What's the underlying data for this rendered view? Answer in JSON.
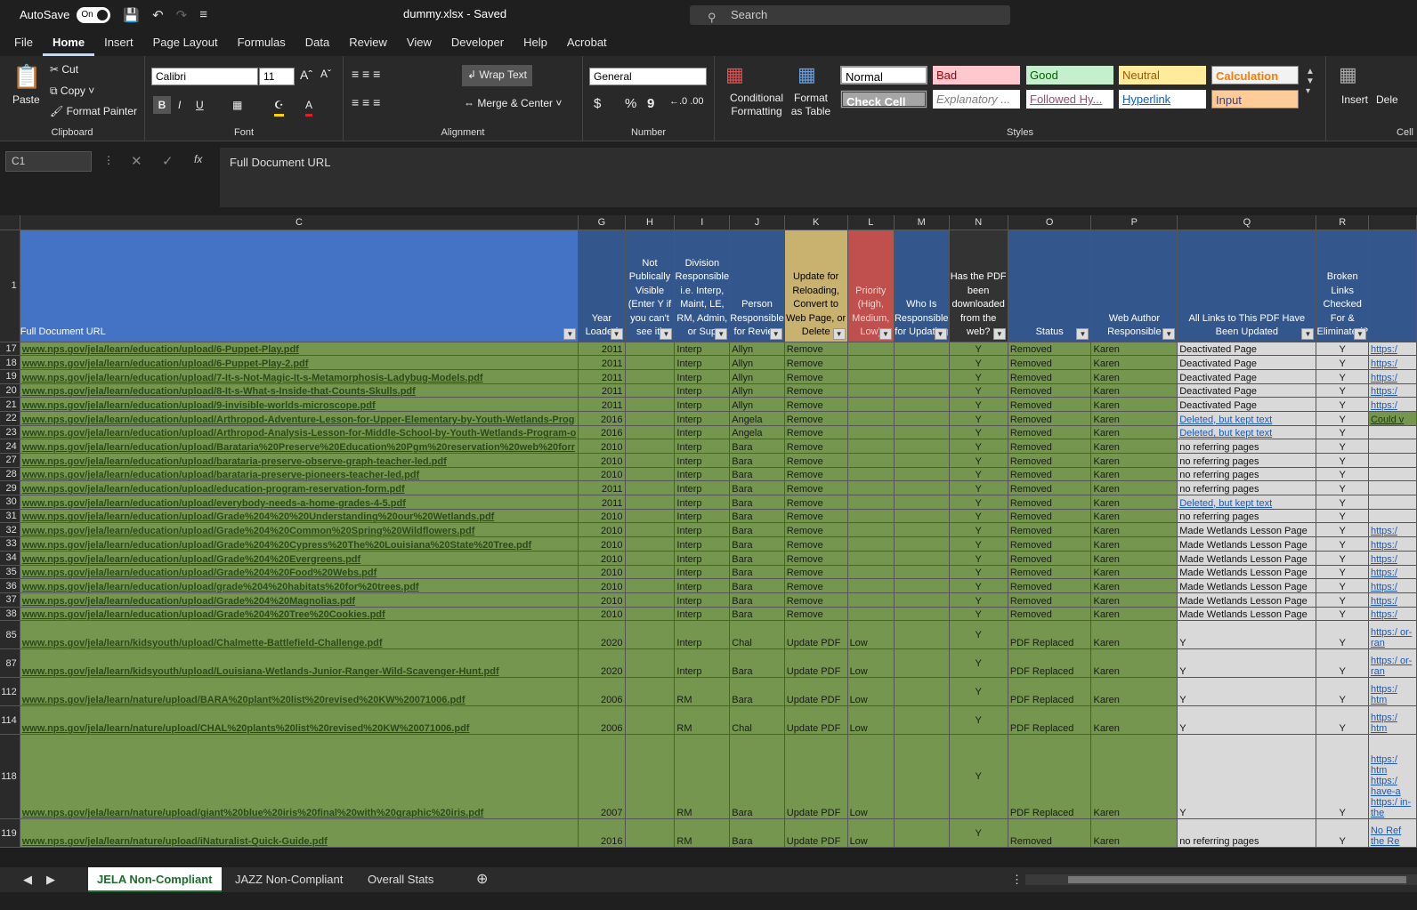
{
  "titlebar": {
    "autosave_label": "AutoSave",
    "autosave_state": "On",
    "doc_title": "dummy.xlsx - Saved",
    "search_placeholder": "Search"
  },
  "menu": [
    "File",
    "Home",
    "Insert",
    "Page Layout",
    "Formulas",
    "Data",
    "Review",
    "View",
    "Developer",
    "Help",
    "Acrobat"
  ],
  "ribbon": {
    "clipboard": {
      "paste": "Paste",
      "cut": "Cut",
      "copy": "Copy",
      "format_painter": "Format Painter",
      "label": "Clipboard"
    },
    "font": {
      "name": "Calibri",
      "size": "11",
      "label": "Font",
      "bold": "B",
      "italic": "I",
      "underline": "U"
    },
    "alignment": {
      "wrap": "Wrap Text",
      "merge": "Merge & Center",
      "label": "Alignment"
    },
    "number": {
      "format": "General",
      "label": "Number",
      "dollar": "$",
      "percent": "%",
      "comma": "9"
    },
    "styles": {
      "conditional": "Conditional Formatting",
      "format_table": "Format as Table",
      "label": "Styles",
      "cells": [
        "Normal",
        "Bad",
        "Good",
        "Neutral",
        "Calculation",
        "Check Cell",
        "Explanatory ...",
        "Followed Hy...",
        "Hyperlink",
        "Input"
      ]
    },
    "cells": {
      "insert": "Insert",
      "delete": "Dele",
      "label": "Cell"
    }
  },
  "formula_bar": {
    "name_box": "C1",
    "content": "Full Document URL",
    "fx": "fx"
  },
  "columns": [
    "C",
    "G",
    "H",
    "I",
    "J",
    "K",
    "L",
    "M",
    "N",
    "O",
    "P",
    "Q",
    "R"
  ],
  "headers": {
    "C": "Full Document URL",
    "G": "Year Loaded",
    "H": "Not Publically Visible (Enter Y if you can't see it)",
    "I": "Division Responsible i.e. Interp, Maint, LE, RM, Admin, or Sup",
    "J": "Person Responsible for Review",
    "K": "Update for Reloading, Convert to Web Page, or Delete",
    "L": "Priority (High, Medium, Low)",
    "M": "Who Is Responsible for Updating",
    "N": "Has the PDF been downloaded from the web?",
    "O": "Status",
    "P": "Web Author Responsible",
    "Q": "All Links to This PDF Have Been Updated",
    "R": "Broken Links Checked For & Eliminated?"
  },
  "rows": [
    {
      "n": "17",
      "url": "www.nps.gov/jela/learn/education/upload/6-Puppet-Play.pdf",
      "g": "2011",
      "i": "Interp",
      "j": "Allyn",
      "k": "Remove",
      "l": "",
      "n2": "Y",
      "o": "Removed",
      "p": "Karen",
      "q": "Deactivated Page",
      "r": "Y",
      "s": "https:/"
    },
    {
      "n": "18",
      "url": "www.nps.gov/jela/learn/education/upload/6-Puppet-Play-2.pdf",
      "g": "2011",
      "i": "Interp",
      "j": "Allyn",
      "k": "Remove",
      "l": "",
      "n2": "Y",
      "o": "Removed",
      "p": "Karen",
      "q": "Deactivated Page",
      "r": "Y",
      "s": "https:/"
    },
    {
      "n": "19",
      "url": "www.nps.gov/jela/learn/education/upload/7-It-s-Not-Magic-It-s-Metamorphosis-Ladybug-Models.pdf",
      "g": "2011",
      "i": "Interp",
      "j": "Allyn",
      "k": "Remove",
      "l": "",
      "n2": "Y",
      "o": "Removed",
      "p": "Karen",
      "q": "Deactivated Page",
      "r": "Y",
      "s": "https:/"
    },
    {
      "n": "20",
      "url": "www.nps.gov/jela/learn/education/upload/8-It-s-What-s-Inside-that-Counts-Skulls.pdf",
      "g": "2011",
      "i": "Interp",
      "j": "Allyn",
      "k": "Remove",
      "l": "",
      "n2": "Y",
      "o": "Removed",
      "p": "Karen",
      "q": "Deactivated Page",
      "r": "Y",
      "s": "https:/"
    },
    {
      "n": "21",
      "url": "www.nps.gov/jela/learn/education/upload/9-invisible-worlds-microscope.pdf",
      "g": "2011",
      "i": "Interp",
      "j": "Allyn",
      "k": "Remove",
      "l": "",
      "n2": "Y",
      "o": "Removed",
      "p": "Karen",
      "q": "Deactivated Page",
      "r": "Y",
      "s": "https:/"
    },
    {
      "n": "22",
      "url": "www.nps.gov/jela/learn/education/upload/Arthropod-Adventure-Lesson-for-Upper-Elementary-by-Youth-Wetlands-Prog",
      "g": "2016",
      "i": "Interp",
      "j": "Angela",
      "k": "Remove",
      "l": "",
      "n2": "Y",
      "o": "Removed",
      "p": "Karen",
      "q": "Deleted, but kept text",
      "qlink": true,
      "r": "Y",
      "s": "Could v"
    },
    {
      "n": "23",
      "url": "www.nps.gov/jela/learn/education/upload/Arthropod-Analysis-Lesson-for-Middle-School-by-Youth-Wetlands-Program-o",
      "g": "2016",
      "i": "Interp",
      "j": "Angela",
      "k": "Remove",
      "l": "",
      "n2": "Y",
      "o": "Removed",
      "p": "Karen",
      "q": "Deleted, but kept text",
      "qlink": true,
      "r": "Y",
      "s": ""
    },
    {
      "n": "24",
      "url": "www.nps.gov/jela/learn/education/upload/Barataria%20Preserve%20Education%20Pgm%20reservation%20web%20forr",
      "g": "2010",
      "i": "Interp",
      "j": "Bara",
      "k": "Remove",
      "l": "",
      "n2": "Y",
      "o": "Removed",
      "p": "Karen",
      "q": "no referring pages",
      "r": "Y",
      "s": ""
    },
    {
      "n": "27",
      "url": "www.nps.gov/jela/learn/education/upload/barataria-preserve-observe-graph-teacher-led.pdf",
      "g": "2010",
      "i": "Interp",
      "j": "Bara",
      "k": "Remove",
      "l": "",
      "n2": "Y",
      "o": "Removed",
      "p": "Karen",
      "q": "no referring pages",
      "r": "Y",
      "s": ""
    },
    {
      "n": "28",
      "url": "www.nps.gov/jela/learn/education/upload/barataria-preserve-pioneers-teacher-led.pdf",
      "g": "2010",
      "i": "Interp",
      "j": "Bara",
      "k": "Remove",
      "l": "",
      "n2": "Y",
      "o": "Removed",
      "p": "Karen",
      "q": "no referring pages",
      "r": "Y",
      "s": ""
    },
    {
      "n": "29",
      "url": "www.nps.gov/jela/learn/education/upload/education-program-reservation-form.pdf",
      "g": "2011",
      "i": "Interp",
      "j": "Bara",
      "k": "Remove",
      "l": "",
      "n2": "Y",
      "o": "Removed",
      "p": "Karen",
      "q": "no referring pages",
      "r": "Y",
      "s": ""
    },
    {
      "n": "30",
      "url": "www.nps.gov/jela/learn/education/upload/everybody-needs-a-home-grades-4-5.pdf",
      "g": "2011",
      "i": "Interp",
      "j": "Bara",
      "k": "Remove",
      "l": "",
      "n2": "Y",
      "o": "Removed",
      "p": "Karen",
      "q": "Deleted, but kept text",
      "qlink": true,
      "r": "Y",
      "s": ""
    },
    {
      "n": "31",
      "url": "www.nps.gov/jela/learn/education/upload/Grade%204%20%20Understanding%20our%20Wetlands.pdf",
      "g": "2010",
      "i": "Interp",
      "j": "Bara",
      "k": "Remove",
      "l": "",
      "n2": "Y",
      "o": "Removed",
      "p": "Karen",
      "q": "no referring pages",
      "r": "Y",
      "s": ""
    },
    {
      "n": "32",
      "url": "www.nps.gov/jela/learn/education/upload/Grade%204%20Common%20Spring%20Wildflowers.pdf",
      "g": "2010",
      "i": "Interp",
      "j": "Bara",
      "k": "Remove",
      "l": "",
      "n2": "Y",
      "o": "Removed",
      "p": "Karen",
      "q": "Made Wetlands Lesson Page",
      "r": "Y",
      "s": "https:/"
    },
    {
      "n": "33",
      "url": "www.nps.gov/jela/learn/education/upload/Grade%204%20Cypress%20The%20Louisiana%20State%20Tree.pdf",
      "g": "2010",
      "i": "Interp",
      "j": "Bara",
      "k": "Remove",
      "l": "",
      "n2": "Y",
      "o": "Removed",
      "p": "Karen",
      "q": "Made Wetlands Lesson Page",
      "r": "Y",
      "s": "https:/"
    },
    {
      "n": "34",
      "url": "www.nps.gov/jela/learn/education/upload/Grade%204%20Evergreens.pdf",
      "g": "2010",
      "i": "Interp",
      "j": "Bara",
      "k": "Remove",
      "l": "",
      "n2": "Y",
      "o": "Removed",
      "p": "Karen",
      "q": "Made Wetlands Lesson Page",
      "r": "Y",
      "s": "https:/"
    },
    {
      "n": "35",
      "url": "www.nps.gov/jela/learn/education/upload/Grade%204%20Food%20Webs.pdf",
      "g": "2010",
      "i": "Interp",
      "j": "Bara",
      "k": "Remove",
      "l": "",
      "n2": "Y",
      "o": "Removed",
      "p": "Karen",
      "q": "Made Wetlands Lesson Page",
      "r": "Y",
      "s": "https:/"
    },
    {
      "n": "36",
      "url": "www.nps.gov/jela/learn/education/upload/grade%204%20habitats%20for%20trees.pdf",
      "g": "2010",
      "i": "Interp",
      "j": "Bara",
      "k": "Remove",
      "l": "",
      "n2": "Y",
      "o": "Removed",
      "p": "Karen",
      "q": "Made Wetlands Lesson Page",
      "r": "Y",
      "s": "https:/"
    },
    {
      "n": "37",
      "url": "www.nps.gov/jela/learn/education/upload/Grade%204%20Magnolias.pdf",
      "g": "2010",
      "i": "Interp",
      "j": "Bara",
      "k": "Remove",
      "l": "",
      "n2": "Y",
      "o": "Removed",
      "p": "Karen",
      "q": "Made Wetlands Lesson Page",
      "r": "Y",
      "s": "https:/"
    },
    {
      "n": "38",
      "url": "www.nps.gov/jela/learn/education/upload/Grade%204%20Tree%20Cookies.pdf",
      "g": "2010",
      "i": "Interp",
      "j": "Bara",
      "k": "Remove",
      "l": "",
      "n2": "Y",
      "o": "Removed",
      "p": "Karen",
      "q": "Made Wetlands Lesson Page",
      "r": "Y",
      "s": "https:/"
    },
    {
      "n": "85",
      "url": "www.nps.gov/jela/learn/kidsyouth/upload/Chalmette-Battlefield-Challenge.pdf",
      "g": "2020",
      "i": "Interp",
      "j": "Chal",
      "k": "Update PDF",
      "l": "Low",
      "n2": "Y",
      "o": "PDF Replaced",
      "p": "Karen",
      "q": "Y",
      "r": "Y",
      "s": "https:/ or-ran",
      "tall": true
    },
    {
      "n": "87",
      "url": "www.nps.gov/jela/learn/kidsyouth/upload/Louisiana-Wetlands-Junior-Ranger-Wild-Scavenger-Hunt.pdf",
      "g": "2020",
      "i": "Interp",
      "j": "Bara",
      "k": "Update PDF",
      "l": "Low",
      "n2": "Y",
      "o": "PDF Replaced",
      "p": "Karen",
      "q": "Y",
      "r": "Y",
      "s": "https:/ or-ran",
      "tall": true
    },
    {
      "n": "112",
      "url": "www.nps.gov/jela/learn/nature/upload/BARA%20plant%20list%20revised%20KW%20071006.pdf",
      "g": "2006",
      "i": "RM",
      "j": "Bara",
      "k": "Update PDF",
      "l": "Low",
      "n2": "Y",
      "o": "PDF Replaced",
      "p": "Karen",
      "q": "Y",
      "r": "Y",
      "s": "https:/ htm",
      "tall": true
    },
    {
      "n": "114",
      "url": "www.nps.gov/jela/learn/nature/upload/CHAL%20plants%20list%20revised%20KW%20071006.pdf",
      "g": "2006",
      "i": "RM",
      "j": "Chal",
      "k": "Update PDF",
      "l": "Low",
      "n2": "Y",
      "o": "PDF Replaced",
      "p": "Karen",
      "q": "Y",
      "r": "Y",
      "s": "https:/ htm",
      "tall": true
    },
    {
      "n": "118",
      "url": "www.nps.gov/jela/learn/nature/upload/giant%20blue%20iris%20final%20with%20graphic%20iris.pdf",
      "g": "2007",
      "i": "RM",
      "j": "Bara",
      "k": "Update PDF",
      "l": "Low",
      "n2": "Y",
      "o": "PDF Replaced",
      "p": "Karen",
      "q": "Y",
      "r": "Y",
      "s": "https:/ htm https:/ have-a https:/ in-the",
      "xtall": true
    },
    {
      "n": "119",
      "url": "www.nps.gov/jela/learn/nature/upload/iNaturalist-Quick-Guide.pdf",
      "g": "2016",
      "i": "RM",
      "j": "Bara",
      "k": "Update PDF",
      "l": "Low",
      "n2": "Y",
      "o": "Removed",
      "p": "Karen",
      "q": "no referring pages",
      "r": "Y",
      "s": "No Ref the Re",
      "tall": true
    }
  ],
  "sheet_tabs": [
    "JELA Non-Compliant",
    "JAZZ Non-Compliant",
    "Overall Stats"
  ]
}
